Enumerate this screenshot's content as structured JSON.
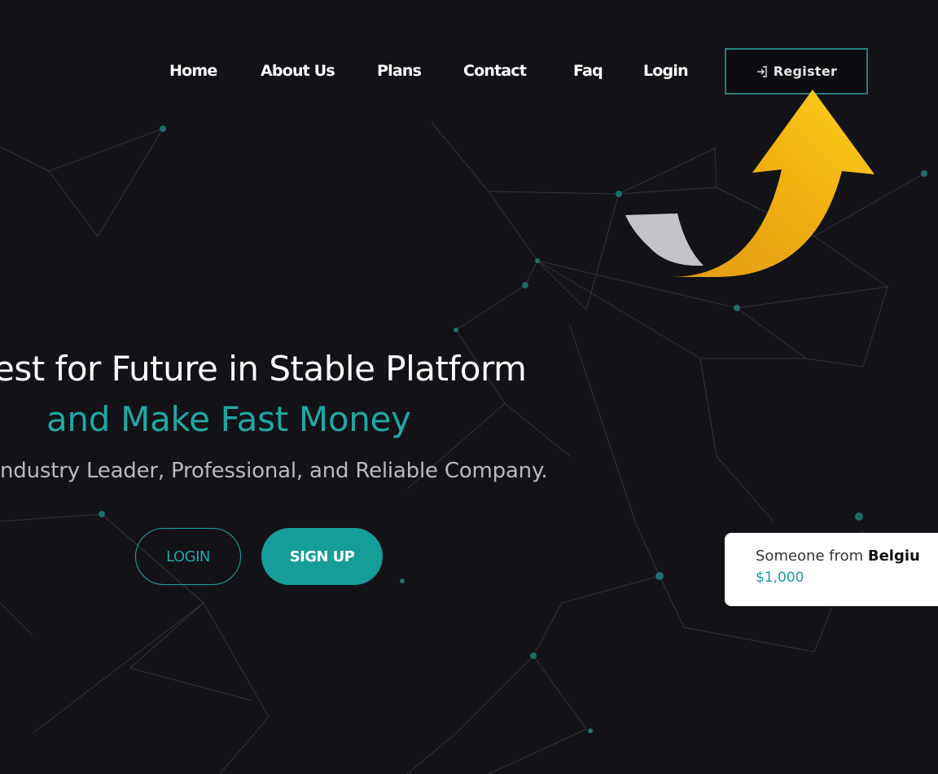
{
  "nav": {
    "items": [
      "Home",
      "About Us",
      "Plans",
      "Contact",
      "Faq",
      "Login"
    ],
    "register_label": "Register"
  },
  "hero": {
    "title": "est for Future in Stable Platform",
    "subtitle": "and Make Fast Money",
    "description": "ndustry Leader, Professional, and Reliable Company."
  },
  "cta": {
    "login_label": "LOGIN",
    "signup_label": "SIGN UP"
  },
  "toast": {
    "prefix": "Someone from ",
    "country": "Belgiu",
    "amount": "$1,000"
  },
  "colors": {
    "background": "#121217",
    "accent": "#1ea8a4",
    "arrow": "#f2b310"
  },
  "icons": {
    "register": "sign-in-icon",
    "annotation": "curved-arrow-icon"
  }
}
